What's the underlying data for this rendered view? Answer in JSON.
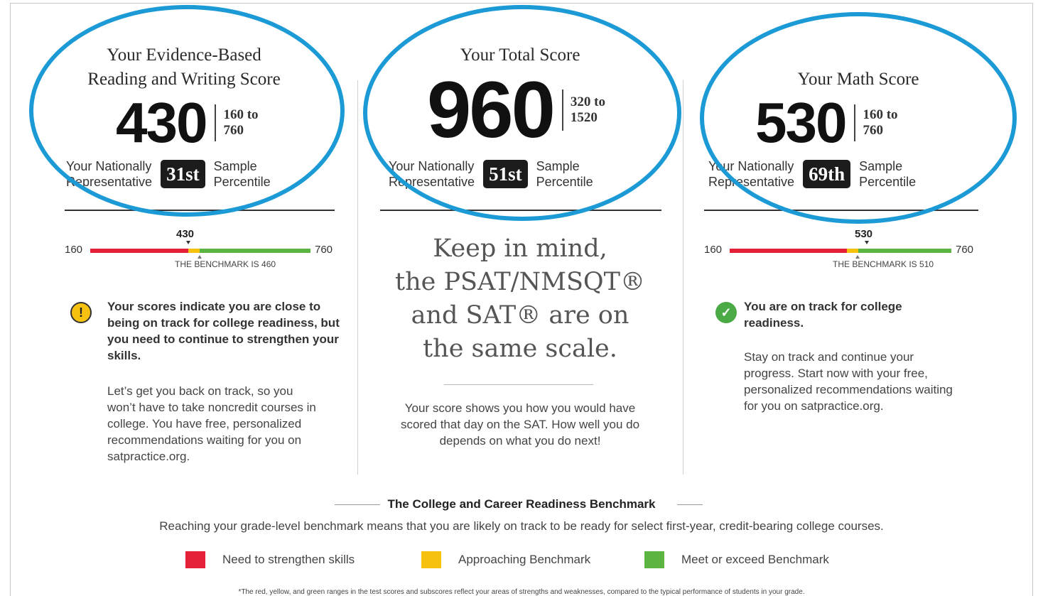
{
  "ebrw": {
    "title_line1": "Your Evidence-Based",
    "title_line2": "Reading and Writing Score",
    "score": "430",
    "range_line1": "160 to",
    "range_line2": "760",
    "pct_left_line1": "Your Nationally",
    "pct_left_line2": "Representative",
    "percentile": "31st",
    "pct_right_line1": "Sample",
    "pct_right_line2": "Percentile",
    "scale_min": "160",
    "scale_max": "760",
    "score_marker": "430",
    "benchmark_text": "THE BENCHMARK IS 460",
    "status_bold": "Your scores indicate you are close to being on track for college readiness, but you need to continue to strengthen your skills.",
    "status_body": "Let’s get you back on track, so you won’t have to take noncredit courses in college. You have free, personalized recommendations waiting for you on satpractice.org.",
    "status_icon": "warning-icon"
  },
  "total": {
    "title": "Your Total Score",
    "score": "960",
    "range_line1": "320 to",
    "range_line2": "1520",
    "pct_left_line1": "Your Nationally",
    "pct_left_line2": "Representative",
    "percentile": "51st",
    "pct_right_line1": "Sample",
    "pct_right_line2": "Percentile",
    "mind_line1": "Keep in mind,",
    "mind_line2": "the PSAT/NMSQT®",
    "mind_line3": "and SAT® are on",
    "mind_line4": "the same scale.",
    "mind_body": "Your score shows you how you would have scored that day on the SAT. How well you do depends on what you do next!"
  },
  "math": {
    "title": "Your Math Score",
    "score": "530",
    "range_line1": "160 to",
    "range_line2": "760",
    "pct_left_line1": "Your Nationally",
    "pct_left_line2": "Representative",
    "percentile": "69th",
    "pct_right_line1": "Sample",
    "pct_right_line2": "Percentile",
    "scale_min": "160",
    "scale_max": "760",
    "score_marker": "530",
    "benchmark_text": "THE BENCHMARK IS 510",
    "status_bold": "You are on track for college readiness.",
    "status_body": "Stay on track and continue your progress. Start now with your free, personalized recommendations waiting for you on satpractice.org.",
    "status_icon": "check-circle-icon"
  },
  "benchmark": {
    "heading": "The College and Career Readiness Benchmark",
    "description": "Reaching your grade-level benchmark means that you are likely on track to be ready for select first-year, credit-bearing college courses.",
    "legend": [
      {
        "label": "Need to strengthen skills",
        "color": "#e5213a"
      },
      {
        "label": "Approaching Benchmark",
        "color": "#f6c20f"
      },
      {
        "label": "Meet or exceed Benchmark",
        "color": "#5cb543"
      }
    ],
    "footnote": "*The red, yellow, and green ranges in the test scores and subscores reflect your areas of strengths and weaknesses, compared to the typical performance of students in your grade."
  },
  "colors": {
    "highlight_circle": "#1b9ad6"
  }
}
